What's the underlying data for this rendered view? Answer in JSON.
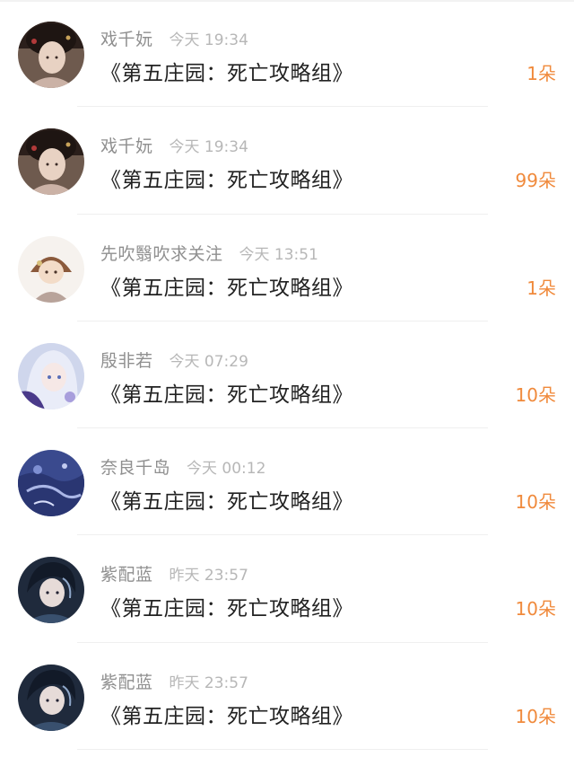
{
  "records": [
    {
      "username": "戏千妧",
      "time": "今天 19:34",
      "book": "《第五庄园：死亡攻略组》",
      "amount": "1朵",
      "avatar_icon": "user-avatar-ancient-lady"
    },
    {
      "username": "戏千妧",
      "time": "今天 19:34",
      "book": "《第五庄园：死亡攻略组》",
      "amount": "99朵",
      "avatar_icon": "user-avatar-ancient-lady"
    },
    {
      "username": "先吹翳吹求关注",
      "time": "今天 13:51",
      "book": "《第五庄园：死亡攻略组》",
      "amount": "1朵",
      "avatar_icon": "user-avatar-chibi"
    },
    {
      "username": "殷非若",
      "time": "今天 07:29",
      "book": "《第五庄园：死亡攻略组》",
      "amount": "10朵",
      "avatar_icon": "user-avatar-anime-girl"
    },
    {
      "username": "奈良千岛",
      "time": "今天 00:12",
      "book": "《第五庄园：死亡攻略组》",
      "amount": "10朵",
      "avatar_icon": "user-avatar-blue-painting"
    },
    {
      "username": "紫配蓝",
      "time": "昨天 23:57",
      "book": "《第五庄园：死亡攻略组》",
      "amount": "10朵",
      "avatar_icon": "user-avatar-dark-hair-man"
    },
    {
      "username": "紫配蓝",
      "time": "昨天 23:57",
      "book": "《第五庄园：死亡攻略组》",
      "amount": "10朵",
      "avatar_icon": "user-avatar-dark-hair-man"
    }
  ],
  "colors": {
    "accent": "#f08a3c",
    "username": "#8f8f8f",
    "time": "#b7b7b7",
    "title": "#222222",
    "divider": "#efefef"
  }
}
